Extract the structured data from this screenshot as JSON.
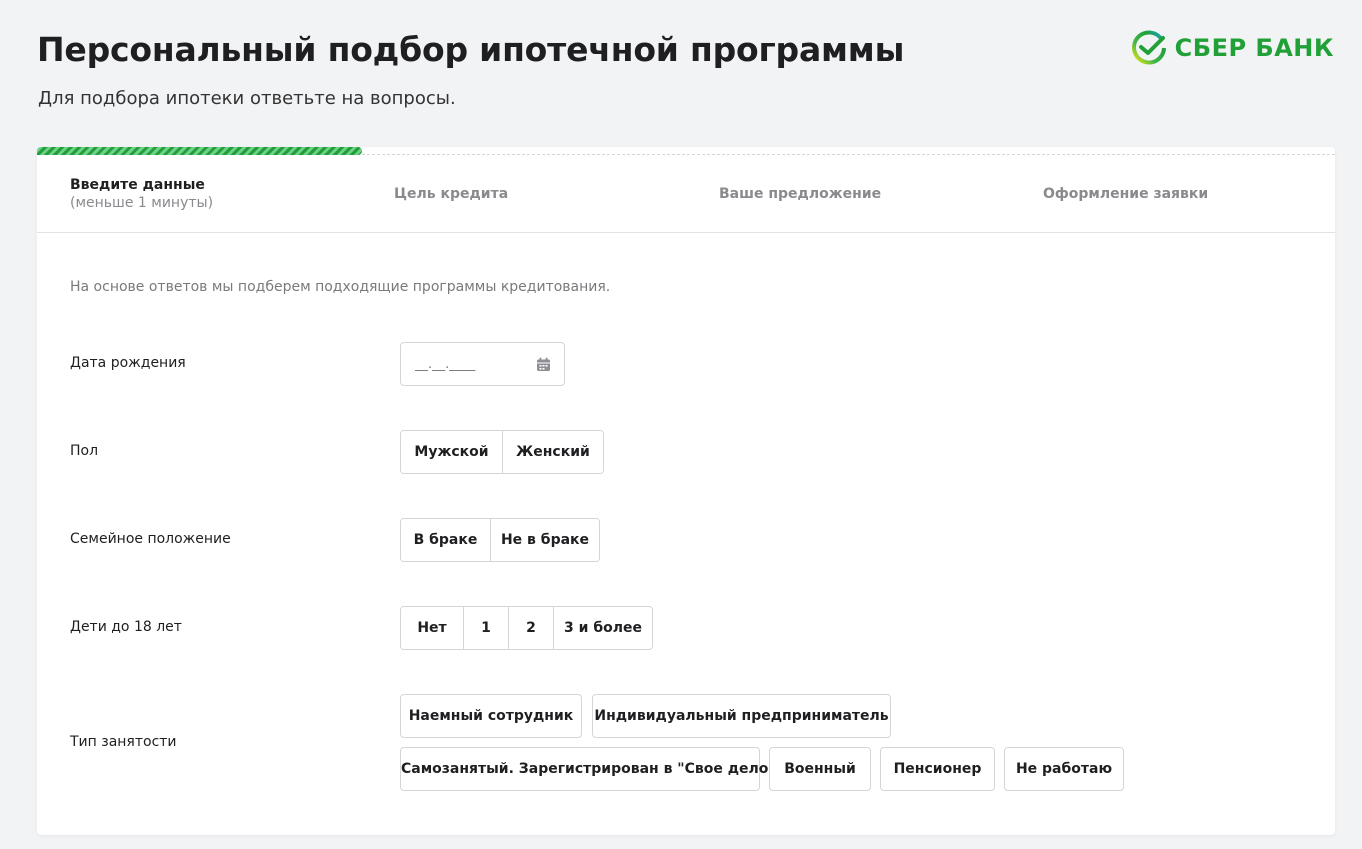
{
  "header": {
    "title": "Персональный подбор ипотечной программы",
    "subtitle": "Для подбора ипотеки ответьте на вопросы.",
    "logo_text": "СБЕР БАНК",
    "brand_color": "#21a038"
  },
  "progress": {
    "value_fraction": 0.25
  },
  "steps": [
    {
      "title": "Введите данные",
      "note": "(меньше 1 минуты)",
      "active": true
    },
    {
      "title": "Цель кредита"
    },
    {
      "title": "Ваше предложение"
    },
    {
      "title": "Оформление заявки"
    }
  ],
  "form": {
    "intro": "На основе ответов мы подберем подходящие программы кредитования.",
    "birthdate": {
      "label": "Дата рождения",
      "placeholder": "__.__.____",
      "icon": "calendar-icon"
    },
    "gender": {
      "label": "Пол",
      "options": [
        "Мужской",
        "Женский"
      ]
    },
    "marital": {
      "label": "Семейное положение",
      "options": [
        "В браке",
        "Не в браке"
      ]
    },
    "children": {
      "label": "Дети до 18 лет",
      "options": [
        "Нет",
        "1",
        "2",
        "3 и более"
      ]
    },
    "employment": {
      "label": "Тип занятости",
      "options": [
        "Наемный сотрудник",
        "Индивидуальный предприниматель",
        "Самозанятый. Зарегистрирован в \"Свое дело\"",
        "Военный",
        "Пенсионер",
        "Не работаю"
      ]
    }
  }
}
